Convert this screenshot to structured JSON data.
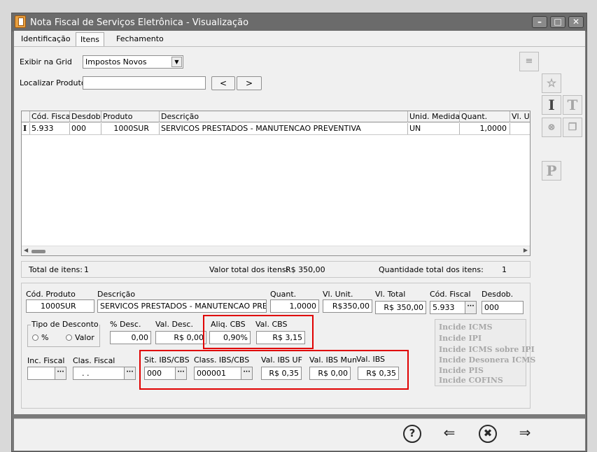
{
  "window": {
    "title": "Nota Fiscal de Serviços Eletrônica - Visualização"
  },
  "tabs": [
    {
      "label": "Identificação"
    },
    {
      "label": "Itens"
    },
    {
      "label": "Fechamento"
    }
  ],
  "grid_select": {
    "label": "Exibir na Grid",
    "value": "Impostos Novos"
  },
  "search": {
    "label": "Localizar Produto",
    "value": "",
    "prev": "<",
    "next": ">"
  },
  "table": {
    "headers": [
      "Cód. Fiscal",
      "Desdob.",
      "Produto",
      "Descrição",
      "Unid. Medida",
      "Quant.",
      "Vl. Ur"
    ],
    "rows": [
      {
        "indicator": "I",
        "cells": [
          "5.933",
          "000",
          "1000SUR",
          "SERVICOS PRESTADOS - MANUTENCAO PREVENTIVA",
          "UN",
          "1,0000",
          "R"
        ]
      }
    ]
  },
  "totals": {
    "items_label": "Total de itens:",
    "items_value": "1",
    "value_label": "Valor total dos itens:",
    "value_value": "R$ 350,00",
    "qty_label": "Quantidade total dos itens:",
    "qty_value": "1"
  },
  "detail": {
    "cod_produto": {
      "label": "Cód. Produto",
      "value": "1000SUR"
    },
    "descricao": {
      "label": "Descrição",
      "value": "SERVICOS PRESTADOS - MANUTENCAO PREVENT"
    },
    "quant": {
      "label": "Quant.",
      "value": "1,0000"
    },
    "vl_unit": {
      "label": "Vl. Unit.",
      "value": "R$350,00"
    },
    "vl_total": {
      "label": "Vl. Total",
      "value": "R$ 350,00"
    },
    "cod_fiscal": {
      "label": "Cód. Fiscal",
      "value": "5.933"
    },
    "desdob": {
      "label": "Desdob.",
      "value": "000"
    },
    "tipo_desconto": {
      "label": "Tipo de Desconto",
      "opt1": "%",
      "opt2": "Valor"
    },
    "perc_desc": {
      "label": "% Desc.",
      "value": "0,00"
    },
    "val_desc": {
      "label": "Val. Desc.",
      "value": "R$ 0,00"
    },
    "aliq_cbs": {
      "label": "Aliq. CBS",
      "value": "0,90%"
    },
    "val_cbs": {
      "label": "Val. CBS",
      "value": "R$ 3,15"
    },
    "inc_fiscal": {
      "label": "Inc. Fiscal",
      "value": ""
    },
    "clas_fiscal": {
      "label": "Clas. Fiscal",
      "value": ". ."
    },
    "sit_ibs": {
      "label": "Sit. IBS/CBS",
      "value": "000"
    },
    "clas_ibs": {
      "label": "Class. IBS/CBS",
      "value": "000001"
    },
    "val_ibs_uf": {
      "label": "Val. IBS UF",
      "value": "R$ 0,35"
    },
    "val_ibs_mun": {
      "label": "Val. IBS Mun",
      "value": "R$ 0,00"
    },
    "val_ibs": {
      "label": "Val. IBS",
      "value": "R$ 0,35"
    }
  },
  "incide": [
    "Incide ICMS",
    "Incide IPI",
    "Incide ICMS sobre IPI",
    "Incide Desonera ICMS",
    "Incide PIS",
    "Incide COFINS"
  ],
  "side_buttons": {
    "i": "I",
    "t": "T",
    "p": "P"
  },
  "footer": {
    "help": "?",
    "back": "⇐",
    "cancel": "✖",
    "next": "⇒"
  },
  "colors": {
    "highlight": "#e00000",
    "title_bar": "#6b6b6b"
  }
}
